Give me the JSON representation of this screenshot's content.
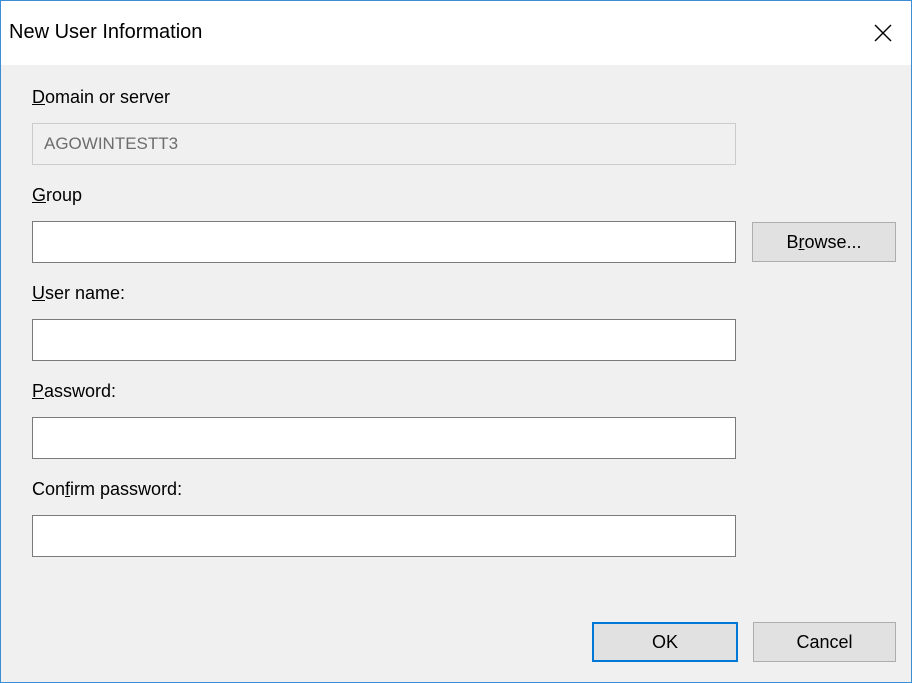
{
  "window": {
    "title": "New User Information"
  },
  "form": {
    "domain": {
      "label_pre": "",
      "label_key": "D",
      "label_post": "omain or server",
      "value": "AGOWINTESTT3"
    },
    "group": {
      "label_pre": "",
      "label_key": "G",
      "label_post": "roup",
      "value": ""
    },
    "username": {
      "label_pre": "",
      "label_key": "U",
      "label_post": "ser name:",
      "value": ""
    },
    "password": {
      "label_pre": "",
      "label_key": "P",
      "label_post": "assword:",
      "value": ""
    },
    "confirm": {
      "label_pre": "Con",
      "label_key": "f",
      "label_post": "irm password:",
      "value": ""
    }
  },
  "buttons": {
    "browse": {
      "pre": "B",
      "key": "r",
      "post": "owse..."
    },
    "ok": "OK",
    "cancel": "Cancel"
  },
  "colors": {
    "window_border": "#3b8ed6",
    "dialog_bg": "#f0f0f0",
    "default_button_border": "#0078d7"
  },
  "icons": {
    "close": "close-icon"
  }
}
